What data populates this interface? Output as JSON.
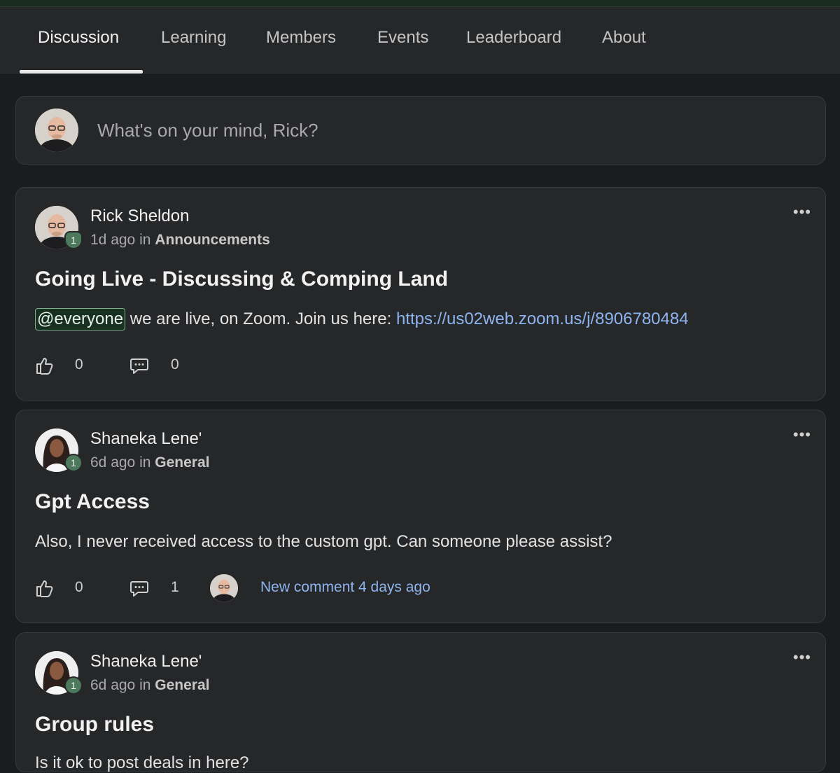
{
  "nav": {
    "tabs": [
      {
        "label": "Discussion",
        "active": true
      },
      {
        "label": "Learning"
      },
      {
        "label": "Members"
      },
      {
        "label": "Events"
      },
      {
        "label": "Leaderboard"
      },
      {
        "label": "About"
      }
    ]
  },
  "composer": {
    "placeholder": "What's on your mind, Rick?"
  },
  "colors": {
    "accent": "#4d7a5c",
    "link": "#8eb4f0",
    "background": "#1b1c1e",
    "card": "#262729"
  },
  "posts": [
    {
      "author": "Rick Sheldon",
      "level": "1",
      "time": "1d ago",
      "in_word": "in",
      "category": "Announcements",
      "title": "Going Live - Discussing & Comping Land",
      "mention": "@everyone",
      "body": "we are live, on Zoom. Join us here:",
      "link": "https://us02web.zoom.us/j/8906780484",
      "likes": "0",
      "comments": "0"
    },
    {
      "author": "Shaneka Lene'",
      "level": "1",
      "time": "6d ago",
      "in_word": "in",
      "category": "General",
      "title": "Gpt Access",
      "body": "Also, I never received access to the custom gpt. Can someone please assist?",
      "likes": "0",
      "comments": "1",
      "new_comment": "New comment 4 days ago"
    },
    {
      "author": "Shaneka Lene'",
      "level": "1",
      "time": "6d ago",
      "in_word": "in",
      "category": "General",
      "title": "Group rules",
      "body": "Is it ok to post deals in here?"
    }
  ],
  "icons": {
    "like": "thumbs-up-icon",
    "comment": "comment-bubble-icon",
    "menu": "more-dots-icon"
  }
}
